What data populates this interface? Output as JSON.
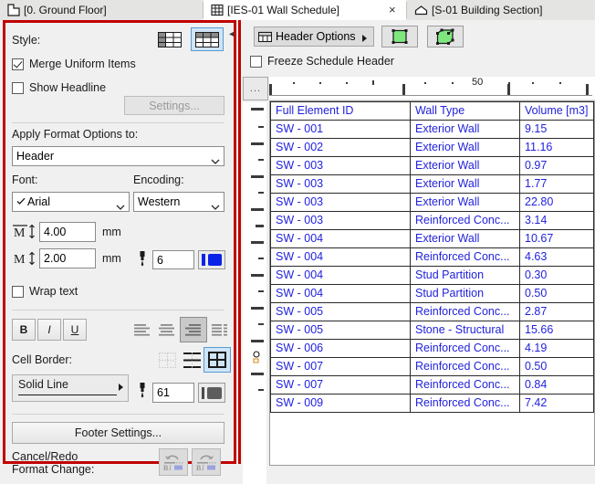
{
  "tabs": [
    {
      "label": "[0. Ground Floor]",
      "icon": "floor-plan-icon",
      "active": false,
      "closable": false
    },
    {
      "label": "[IES-01 Wall Schedule]",
      "icon": "schedule-grid-icon",
      "active": true,
      "closable": true,
      "close_label": "×"
    },
    {
      "label": "[S-01 Building Section]",
      "icon": "section-house-icon",
      "active": false,
      "closable": false
    }
  ],
  "format_panel": {
    "style_label": "Style:",
    "style_buttons": [
      {
        "name": "style-left-header",
        "selected": false
      },
      {
        "name": "style-top-header",
        "selected": true
      }
    ],
    "merge_uniform": {
      "label": "Merge Uniform Items",
      "checked": true
    },
    "show_headline": {
      "label": "Show Headline",
      "checked": false
    },
    "headline_settings_button": {
      "label": "Settings...",
      "enabled": false
    },
    "apply_to_label": "Apply Format Options to:",
    "apply_to_value": "Header",
    "font_label": "Font:",
    "font_value": "Arial",
    "encoding_label": "Encoding:",
    "encoding_value": "Western",
    "text_size": {
      "value": "4.00",
      "unit": "mm",
      "icon": "cap-height-icon"
    },
    "text_size_small": {
      "value": "2.00",
      "unit": "mm",
      "icon": "x-height-icon"
    },
    "text_pen": {
      "value": "6",
      "icon": "pen-icon",
      "color": "#0b23e8"
    },
    "wrap_text": {
      "label": "Wrap text",
      "checked": false
    },
    "bold_label": "B",
    "italic_label": "I",
    "underline_label": "U",
    "alignment": {
      "options": [
        "align-left",
        "align-center",
        "align-right",
        "align-justify"
      ],
      "selected": 2
    },
    "cell_border_label": "Cell Border:",
    "border_options": [
      {
        "name": "border-none",
        "selected": false,
        "enabled": false
      },
      {
        "name": "border-horizontal",
        "selected": false,
        "enabled": true
      },
      {
        "name": "border-all",
        "selected": true,
        "enabled": true
      }
    ],
    "line_type_value": "Solid Line",
    "border_pen": {
      "value": "61",
      "icon": "pen-icon",
      "color": "#5c5c5c"
    },
    "footer_settings_button": "Footer Settings...",
    "cancel_redo_label_line1": "Cancel/Redo",
    "cancel_redo_label_line2": "Format Change:",
    "undo_button": {
      "name": "undo-format-button",
      "enabled": false
    },
    "redo_button": {
      "name": "redo-format-button",
      "enabled": false
    }
  },
  "schedule_toolbar": {
    "collapse_arrow": "◂",
    "header_options": {
      "label": "Header Options",
      "icon": "header-grid-icon",
      "arrow": "▸"
    },
    "select_2d_button": {
      "name": "select-2d-button"
    },
    "select_3d_button": {
      "name": "select-3d-button"
    },
    "freeze_header": {
      "label": "Freeze Schedule Header",
      "checked": false
    },
    "ruler_corner_label": "..."
  },
  "ruler": {
    "h_label": "50"
  },
  "schedule_table": {
    "headers": [
      "Full Element ID",
      "Wall Type",
      "Volume [m3]"
    ],
    "rows": [
      [
        "SW - 001",
        "Exterior Wall",
        "9.15"
      ],
      [
        "SW - 002",
        "Exterior Wall",
        "11.16"
      ],
      [
        "SW - 003",
        "Exterior Wall",
        "0.97"
      ],
      [
        "SW - 003",
        "Exterior Wall",
        "1.77"
      ],
      [
        "SW - 003",
        "Exterior Wall",
        "22.80"
      ],
      [
        "SW - 003",
        "Reinforced Conc...",
        "3.14"
      ],
      [
        "SW - 004",
        "Exterior Wall",
        "10.67"
      ],
      [
        "SW - 004",
        "Reinforced Conc...",
        "4.63"
      ],
      [
        "SW - 004",
        "Stud Partition",
        "0.30"
      ],
      [
        "SW - 004",
        "Stud Partition",
        "0.50"
      ],
      [
        "SW - 005",
        "Reinforced Conc...",
        "2.87"
      ],
      [
        "SW - 005",
        "Stone - Structural",
        "15.66"
      ],
      [
        "SW - 006",
        "Reinforced Conc...",
        "4.19"
      ],
      [
        "SW - 007",
        "Reinforced Conc...",
        "0.50"
      ],
      [
        "SW - 007",
        "Reinforced Conc...",
        "0.84"
      ],
      [
        "SW - 009",
        "Reinforced Conc...",
        "7.42"
      ]
    ]
  },
  "colors": {
    "accent_red": "#c00000",
    "table_text": "#2222dd",
    "selection_blue": "#cfe5f7",
    "green_icon": "#7ee87e"
  }
}
